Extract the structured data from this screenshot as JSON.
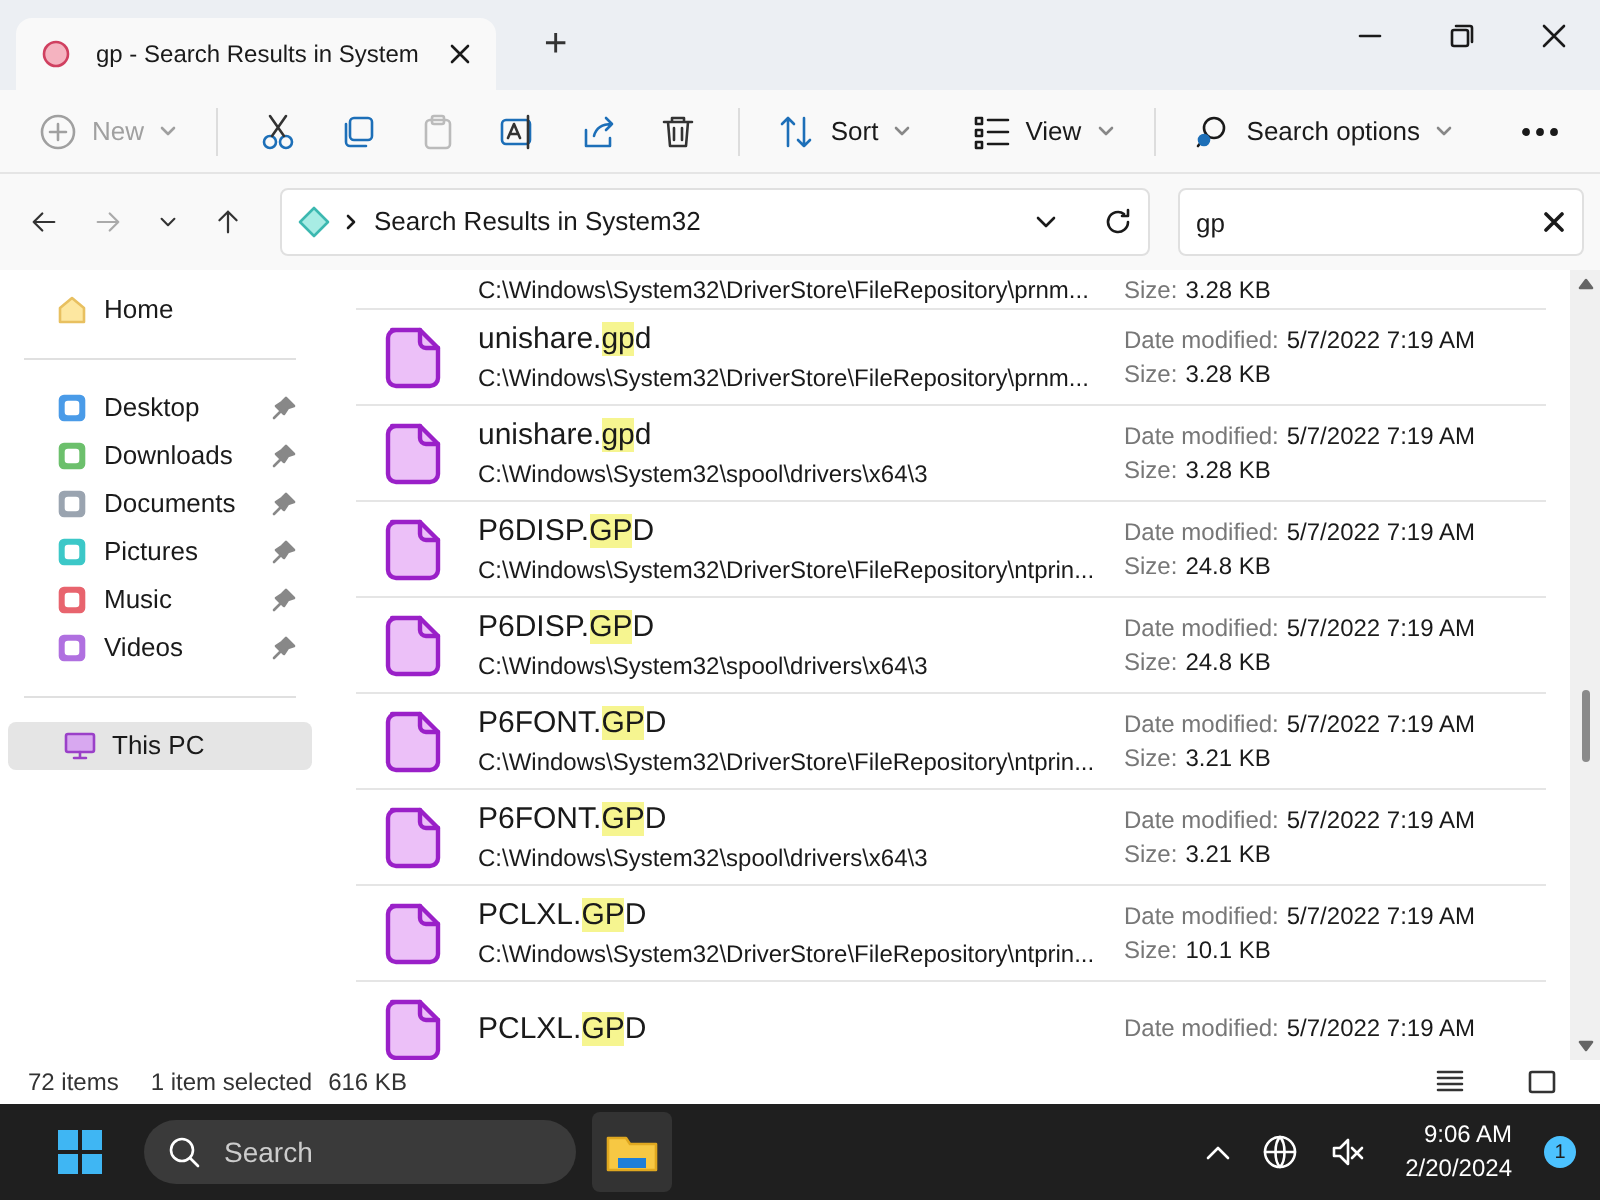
{
  "window": {
    "tab_title": "gp - Search Results in System",
    "new_tab": "+"
  },
  "toolbar": {
    "new": {
      "label": "New",
      "disabled": true
    },
    "sort": "Sort",
    "view": "View",
    "search_options": "Search options"
  },
  "address": {
    "path": "Search Results in System32",
    "search_value": "gp"
  },
  "sidebar": {
    "home": "Home",
    "pinned": [
      {
        "label": "Desktop",
        "color": "#4a9be8"
      },
      {
        "label": "Downloads",
        "color": "#6cc06c"
      },
      {
        "label": "Documents",
        "color": "#9aa4b0"
      },
      {
        "label": "Pictures",
        "color": "#3cc8c8"
      },
      {
        "label": "Music",
        "color": "#e8646e"
      },
      {
        "label": "Videos",
        "color": "#b070e0"
      }
    ],
    "this_pc": {
      "label": "This PC",
      "selected": true
    }
  },
  "results": [
    {
      "path": "C:\\Windows\\System32\\DriverStore\\FileRepository\\prnm...",
      "size_label": "Size:",
      "size": "3.28 KB"
    },
    {
      "name": [
        {
          "text": "unishare.",
          "highlight": false
        },
        {
          "text": "gp",
          "highlight": true
        },
        {
          "text": "d",
          "highlight": false
        }
      ],
      "path": "C:\\Windows\\System32\\DriverStore\\FileRepository\\prnm...",
      "date_label": "Date modified:",
      "date": "5/7/2022 7:19 AM",
      "size_label": "Size:",
      "size": "3.28 KB"
    },
    {
      "name": [
        {
          "text": "unishare.",
          "highlight": false
        },
        {
          "text": "gp",
          "highlight": true
        },
        {
          "text": "d",
          "highlight": false
        }
      ],
      "path": "C:\\Windows\\System32\\spool\\drivers\\x64\\3",
      "date_label": "Date modified:",
      "date": "5/7/2022 7:19 AM",
      "size_label": "Size:",
      "size": "3.28 KB"
    },
    {
      "name": [
        {
          "text": "P6DISP.",
          "highlight": false
        },
        {
          "text": "GP",
          "highlight": true
        },
        {
          "text": "D",
          "highlight": false
        }
      ],
      "path": "C:\\Windows\\System32\\DriverStore\\FileRepository\\ntprin...",
      "date_label": "Date modified:",
      "date": "5/7/2022 7:19 AM",
      "size_label": "Size:",
      "size": "24.8 KB"
    },
    {
      "name": [
        {
          "text": "P6DISP.",
          "highlight": false
        },
        {
          "text": "GP",
          "highlight": true
        },
        {
          "text": "D",
          "highlight": false
        }
      ],
      "path": "C:\\Windows\\System32\\spool\\drivers\\x64\\3",
      "date_label": "Date modified:",
      "date": "5/7/2022 7:19 AM",
      "size_label": "Size:",
      "size": "24.8 KB"
    },
    {
      "name": [
        {
          "text": "P6FONT.",
          "highlight": false
        },
        {
          "text": "GP",
          "highlight": true
        },
        {
          "text": "D",
          "highlight": false
        }
      ],
      "path": "C:\\Windows\\System32\\DriverStore\\FileRepository\\ntprin...",
      "date_label": "Date modified:",
      "date": "5/7/2022 7:19 AM",
      "size_label": "Size:",
      "size": "3.21 KB"
    },
    {
      "name": [
        {
          "text": "P6FONT.",
          "highlight": false
        },
        {
          "text": "GP",
          "highlight": true
        },
        {
          "text": "D",
          "highlight": false
        }
      ],
      "path": "C:\\Windows\\System32\\spool\\drivers\\x64\\3",
      "date_label": "Date modified:",
      "date": "5/7/2022 7:19 AM",
      "size_label": "Size:",
      "size": "3.21 KB"
    },
    {
      "name": [
        {
          "text": "PCLXL.",
          "highlight": false
        },
        {
          "text": "GP",
          "highlight": true
        },
        {
          "text": "D",
          "highlight": false
        }
      ],
      "path": "C:\\Windows\\System32\\DriverStore\\FileRepository\\ntprin...",
      "date_label": "Date modified:",
      "date": "5/7/2022 7:19 AM",
      "size_label": "Size:",
      "size": "10.1 KB"
    },
    {
      "name": [
        {
          "text": "PCLXL.",
          "highlight": false
        },
        {
          "text": "GP",
          "highlight": true
        },
        {
          "text": "D",
          "highlight": false
        }
      ],
      "date_label": "Date modified:",
      "date": "5/7/2022 7:19 AM"
    }
  ],
  "status_bar": {
    "count": "72 items",
    "selection": "1 item selected",
    "size": "616 KB"
  },
  "taskbar": {
    "search": "Search",
    "time": "9:06 AM",
    "date": "2/20/2024",
    "notifications": "1"
  }
}
